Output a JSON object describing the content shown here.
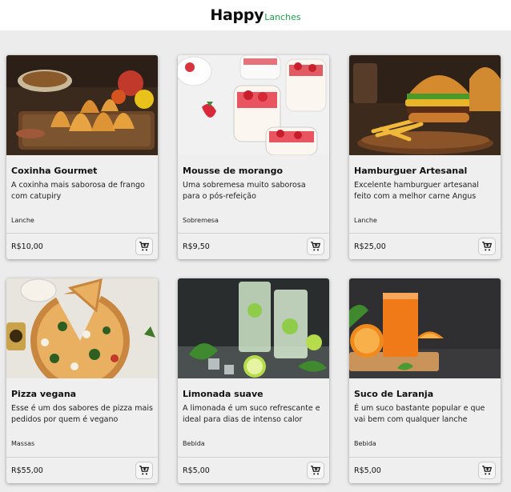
{
  "header": {
    "brand_main": "Happy",
    "brand_sub": "Lanches"
  },
  "products": [
    {
      "title": "Coxinha Gourmet",
      "description": "A coxinha mais saborosa de frango com catupiry",
      "category": "Lanche",
      "price": "R$10,00"
    },
    {
      "title": "Mousse de morango",
      "description": "Uma sobremesa muito saborosa para o pós-refeição",
      "category": "Sobremesa",
      "price": "R$9,50"
    },
    {
      "title": "Hamburguer Artesanal",
      "description": "Excelente hamburguer artesanal feito com a melhor carne Angus",
      "category": "Lanche",
      "price": "R$25,00"
    },
    {
      "title": "Pizza vegana",
      "description": "Esse é um dos sabores de pizza mais pedidos por quem é vegano",
      "category": "Massas",
      "price": "R$55,00"
    },
    {
      "title": "Limonada suave",
      "description": "A limonada é um suco refrescante e ideal para dias de intenso calor",
      "category": "Bebida",
      "price": "R$5,00"
    },
    {
      "title": "Suco de Laranja",
      "description": "É um suco bastante popular e que vai bem com qualquer lanche",
      "category": "Bebida",
      "price": "R$5,00"
    }
  ],
  "icons": {
    "cart": "add-to-cart-icon"
  },
  "colors": {
    "brand_accent": "#16a34a",
    "background": "#ececec",
    "card": "#efefef"
  }
}
